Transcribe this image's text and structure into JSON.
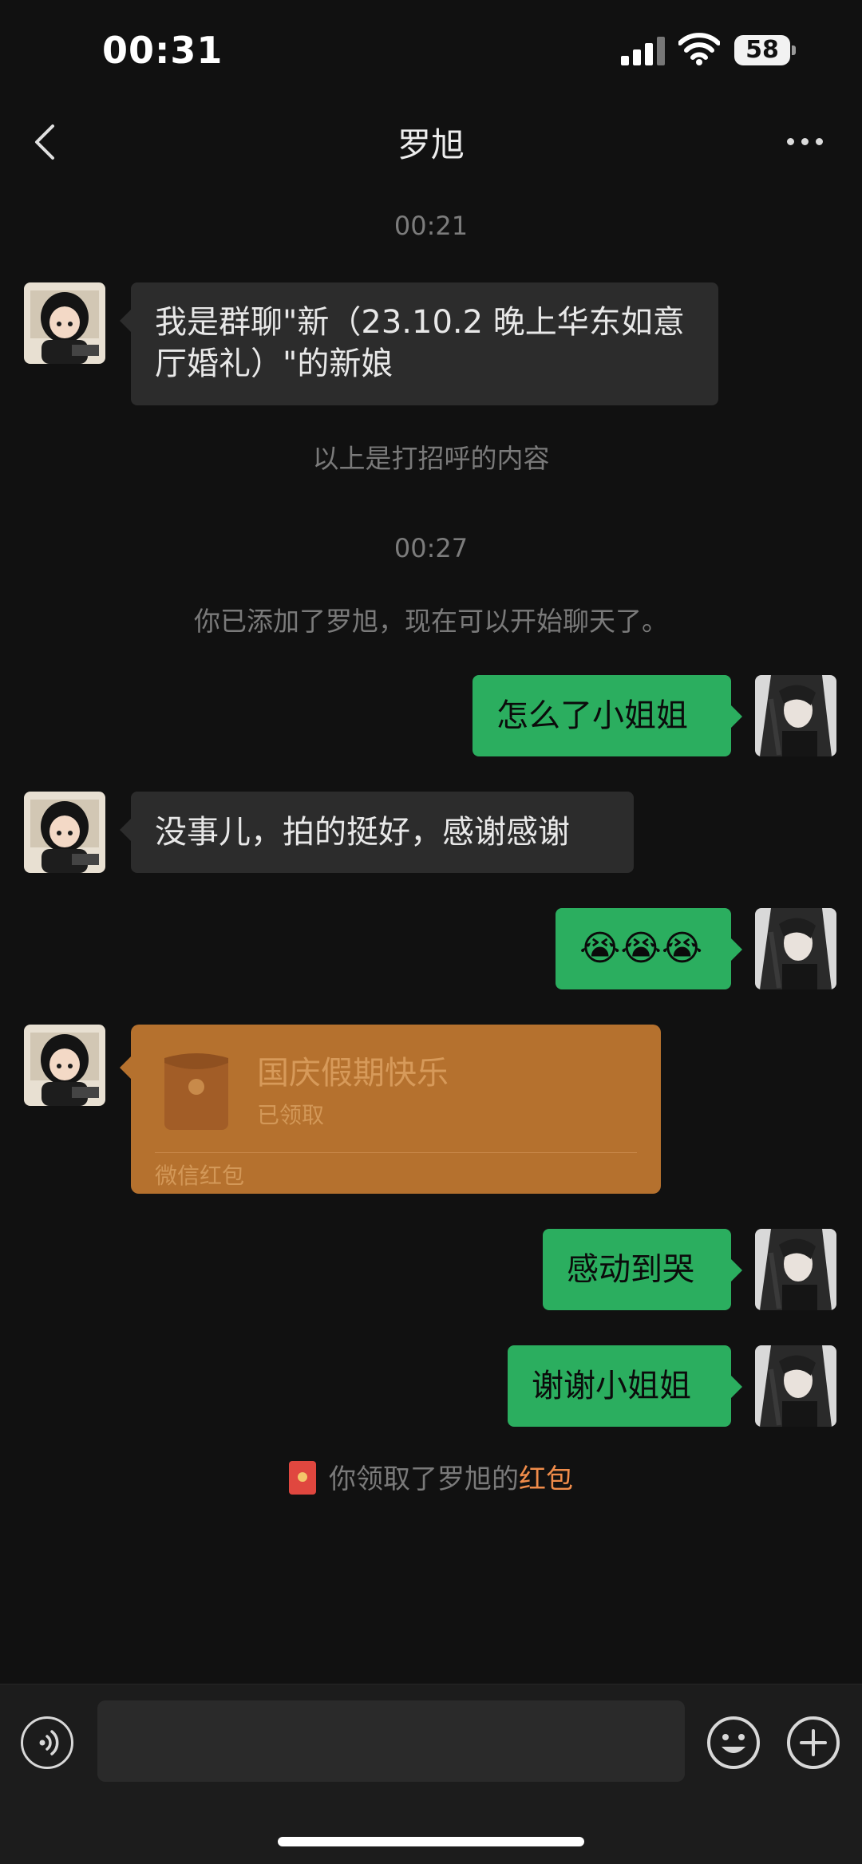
{
  "status_bar": {
    "time": "00:31",
    "battery": "58"
  },
  "nav": {
    "title": "罗旭"
  },
  "messages": {
    "ts1": "00:21",
    "m1": "我是群聊\"新（23.10.2 晚上华东如意厅婚礼）\"的新娘",
    "greeting_note": "以上是打招呼的内容",
    "ts2": "00:27",
    "added_note": "你已添加了罗旭，现在可以开始聊天了。",
    "m2": "怎么了小姐姐",
    "m3": "没事儿，拍的挺好，感谢感谢",
    "m4": "😭😭😭",
    "m5": "感动到哭",
    "m6": "谢谢小姐姐"
  },
  "red_packet": {
    "title": "国庆假期快乐",
    "status": "已领取",
    "footer": "微信红包"
  },
  "claim_note": {
    "prefix": "你领取了罗旭的",
    "link": "红包"
  },
  "input_bar": {
    "value": ""
  },
  "colors": {
    "outgoing_bubble": "#2bae5f",
    "incoming_bubble": "#2c2c2c",
    "red_packet": "#b5712e",
    "link": "#f08c4a"
  }
}
